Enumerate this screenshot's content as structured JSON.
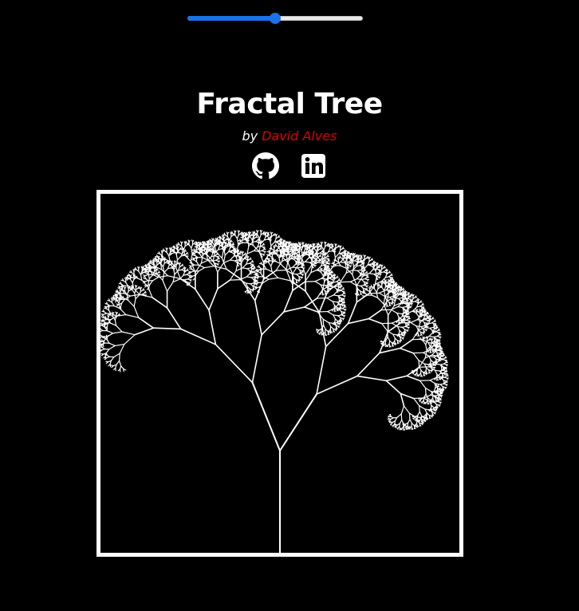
{
  "slider": {
    "value": 0.5,
    "accent": "#1a73e8"
  },
  "header": {
    "title": "Fractal Tree",
    "by_prefix": "by",
    "author": "David Alves",
    "author_color": "#e00000"
  },
  "socials": [
    {
      "icon": "github-icon"
    },
    {
      "icon": "linkedin-icon"
    }
  ],
  "tree": {
    "depth": 11,
    "trunk_color": "#ffffff"
  }
}
